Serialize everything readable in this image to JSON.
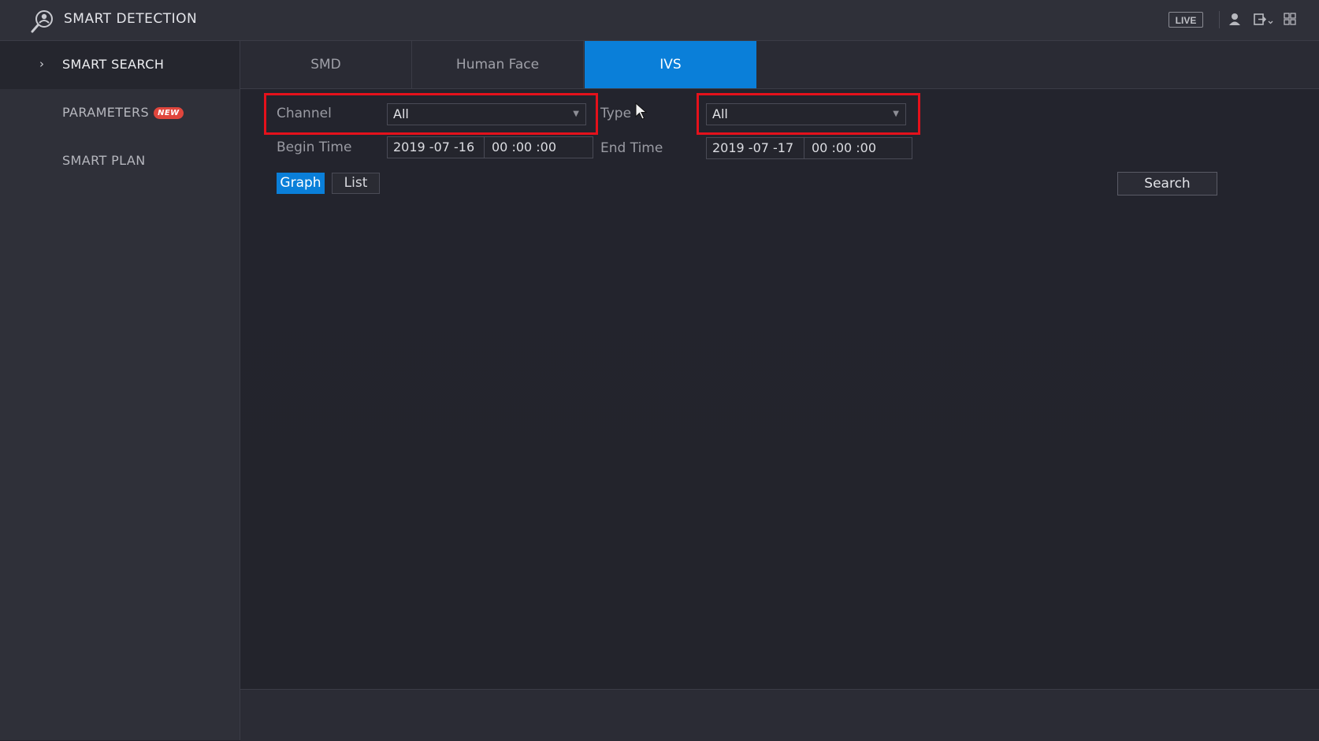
{
  "header": {
    "title": "SMART DETECTION",
    "logo_icon": "smart-detection-icon",
    "live_label": "LIVE",
    "icons": [
      "user-icon",
      "logout-icon",
      "grid-menu-icon"
    ]
  },
  "sidebar": {
    "items": [
      {
        "label": "SMART SEARCH",
        "active": true
      },
      {
        "label": "PARAMETERS",
        "badge": "NEW"
      },
      {
        "label": "SMART PLAN"
      }
    ]
  },
  "tabs": [
    {
      "label": "SMD"
    },
    {
      "label": "Human Face"
    },
    {
      "label": "IVS",
      "active": true
    }
  ],
  "filters": {
    "channel_label": "Channel",
    "channel_value": "All",
    "type_label": "Type",
    "type_value": "All",
    "begin_label": "Begin Time",
    "begin_date": "2019 -07 -16",
    "begin_time": "00 :00 :00",
    "end_label": "End Time",
    "end_date": "2019 -07 -17",
    "end_time": "00 :00 :00"
  },
  "view": {
    "graph_label": "Graph",
    "list_label": "List",
    "selected": "Graph"
  },
  "search_label": "Search",
  "colors": {
    "accent": "#0a7fd9",
    "highlight": "#e5111b",
    "badge": "#e0463d"
  }
}
